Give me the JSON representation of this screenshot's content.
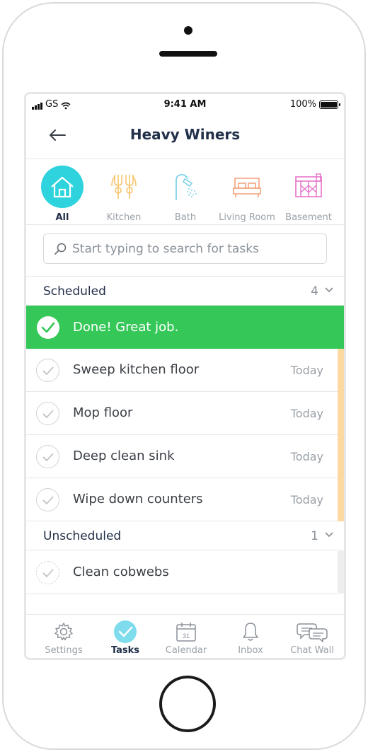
{
  "status_bar": {
    "carrier": "GS",
    "time": "9:41 AM",
    "battery": "100%",
    "battery_level": 1.0
  },
  "header": {
    "title": "Heavy Winers",
    "back_icon": "arrow-left-icon"
  },
  "categories": [
    {
      "label": "All",
      "icon": "house-icon",
      "active": true,
      "color": "#2ed3dd"
    },
    {
      "label": "Kitchen",
      "icon": "utensils-icon",
      "color": "#f7c46c"
    },
    {
      "label": "Bath",
      "icon": "shower-icon",
      "color": "#7fd1ea"
    },
    {
      "label": "Living Room",
      "icon": "bed-icon",
      "color": "#f4a27a"
    },
    {
      "label": "Basement",
      "icon": "basement-icon",
      "color": "#e56fc8"
    }
  ],
  "search": {
    "placeholder": "Start typing to search for tasks"
  },
  "scheduled": {
    "title": "Scheduled",
    "count": "4"
  },
  "done_banner": {
    "text": "Done! Great job.",
    "color": "#35c758"
  },
  "scheduled_tasks": [
    {
      "name": "Sweep kitchen floor",
      "when": "Today"
    },
    {
      "name": "Mop floor",
      "when": "Today"
    },
    {
      "name": "Deep clean sink",
      "when": "Today"
    },
    {
      "name": "Wipe down counters",
      "when": "Today"
    }
  ],
  "unscheduled": {
    "title": "Unscheduled",
    "count": "1"
  },
  "unscheduled_tasks": [
    {
      "name": "Clean cobwebs"
    }
  ],
  "tabs": [
    {
      "label": "Settings",
      "icon": "gear-icon"
    },
    {
      "label": "Tasks",
      "icon": "check-circle-icon",
      "active": true
    },
    {
      "label": "Calendar",
      "icon": "calendar-icon",
      "day": "31"
    },
    {
      "label": "Inbox",
      "icon": "bell-icon"
    },
    {
      "label": "Chat Wall",
      "icon": "chat-bubbles-icon"
    }
  ],
  "colors": {
    "accent": "#2ed3dd",
    "success": "#35c758",
    "scheduled_strip": "#fbd9a0",
    "text_dark": "#22304a"
  }
}
